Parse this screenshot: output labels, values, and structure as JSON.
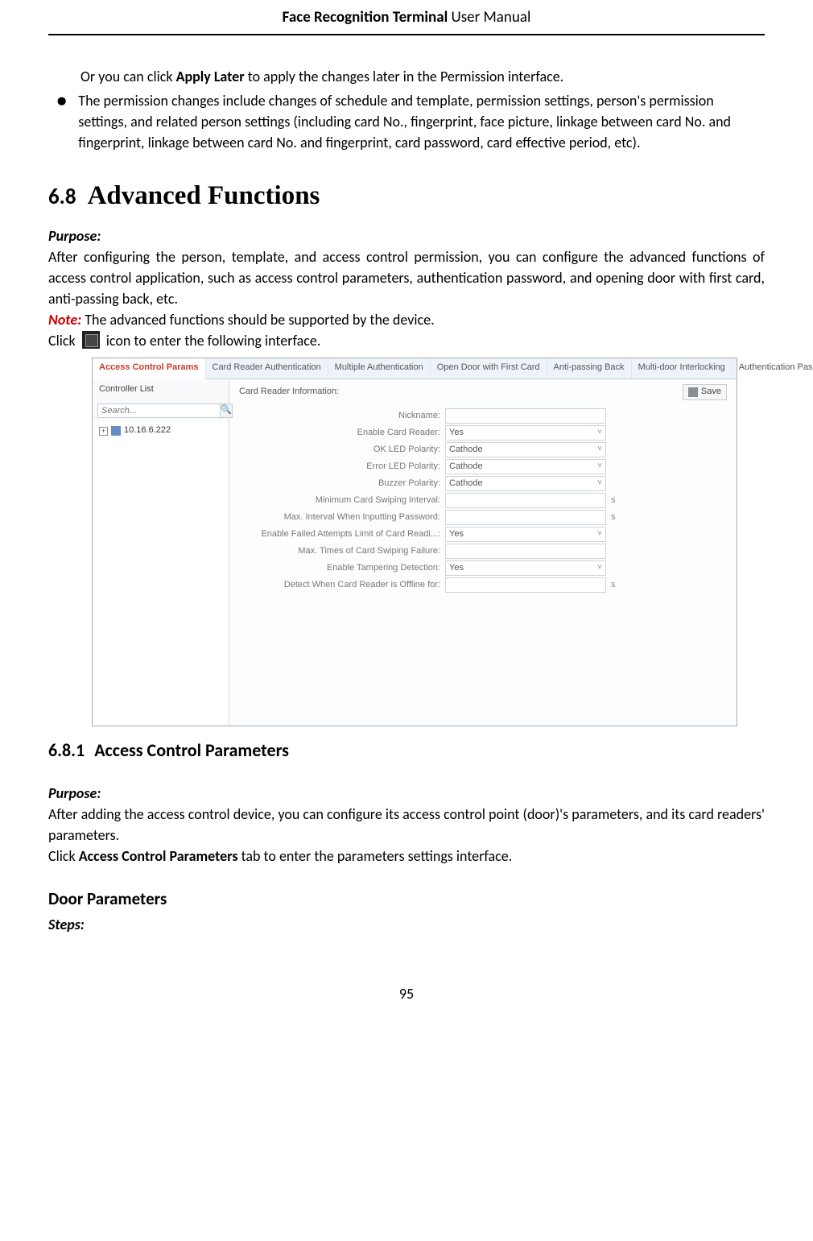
{
  "header": {
    "bold": "Face Recognition Terminal",
    "rest": "  User Manual"
  },
  "intro": {
    "para1_pre": "Or you can click ",
    "para1_bold": "Apply Later",
    "para1_post": " to apply the changes later in the Permission interface.",
    "bullet": "The permission changes include changes of schedule and template, permission settings, person's permission settings, and related person settings (including card No., fingerprint, face picture, linkage between card No. and fingerprint, linkage between card No. and fingerprint, card password, card effective period, etc)."
  },
  "sec": {
    "num": "6.8",
    "title": "Advanced Functions"
  },
  "purpose_label": "Purpose:",
  "purpose_text": "After configuring the person, template, and access control permission, you can configure the advanced functions of access control application, such as access control parameters, authentication password, and opening door with first card, anti-passing back, etc.",
  "note_label": "Note:",
  "note_text": " The advanced functions should be supported by the device.",
  "click_pre": "Click ",
  "click_post": " icon to enter the following interface.",
  "ui": {
    "tabs": [
      "Access Control Params",
      "Card Reader Authentication",
      "Multiple Authentication",
      "Open Door with First Card",
      "Anti-passing Back",
      "Multi-door Interlocking",
      "Authentication Password"
    ],
    "left_header": "Controller List",
    "search_placeholder": "Search...",
    "tree_ip": "10.16.6.222",
    "right_header": "Card Reader Information:",
    "save_label": "Save",
    "fields": [
      {
        "label": "Nickname:",
        "value": "",
        "type": "text"
      },
      {
        "label": "Enable Card Reader:",
        "value": "Yes",
        "type": "select"
      },
      {
        "label": "OK LED Polarity:",
        "value": "Cathode",
        "type": "select"
      },
      {
        "label": "Error LED Polarity:",
        "value": "Cathode",
        "type": "select"
      },
      {
        "label": "Buzzer Polarity:",
        "value": "Cathode",
        "type": "select"
      },
      {
        "label": "Minimum Card Swiping Interval:",
        "value": "",
        "type": "text",
        "unit": "s"
      },
      {
        "label": "Max. Interval When Inputting Password:",
        "value": "",
        "type": "text",
        "unit": "s"
      },
      {
        "label": "Enable Failed Attempts Limit of Card Readi...:",
        "value": "Yes",
        "type": "select"
      },
      {
        "label": "Max. Times of Card Swiping Failure:",
        "value": "",
        "type": "text"
      },
      {
        "label": "Enable Tampering Detection:",
        "value": "Yes",
        "type": "select"
      },
      {
        "label": "Detect When Card Reader is Offline for:",
        "value": "",
        "type": "text",
        "unit": "s"
      }
    ]
  },
  "sub": {
    "num": "6.8.1",
    "title": "Access Control Parameters"
  },
  "sub_purpose": "After adding the access control device, you can configure its access control point (door)'s parameters, and its card readers' parameters.",
  "sub_click_pre": "Click ",
  "sub_click_bold": "Access Control Parameters",
  "sub_click_post": " tab to enter the parameters settings interface.",
  "door_h": "Door Parameters",
  "steps_label": "Steps:",
  "page_num": "95"
}
